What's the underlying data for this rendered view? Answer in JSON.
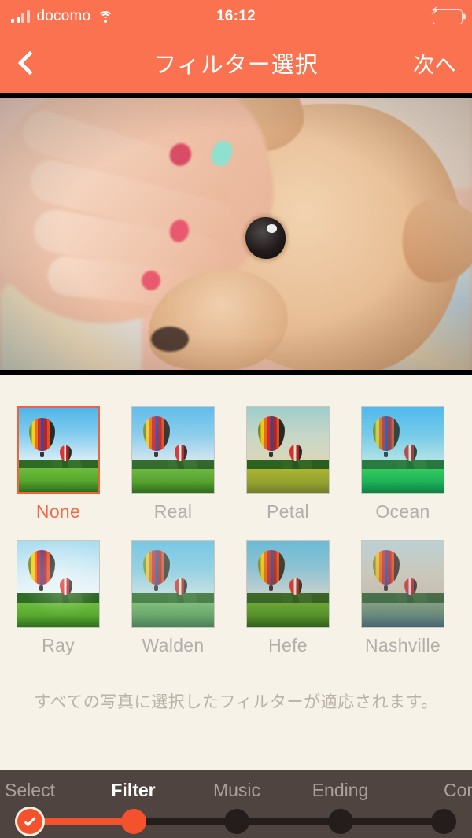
{
  "status_bar": {
    "carrier": "docomo",
    "time": "16:12",
    "signal_icon": "signal-bars-icon",
    "wifi_icon": "wifi-icon",
    "battery_icon": "battery-charging-icon",
    "battery_color": "#3ed64a"
  },
  "nav": {
    "back_icon": "chevron-left-icon",
    "title": "フィルター選択",
    "next_label": "次へ"
  },
  "preview": {
    "description": "chihuahua dog held by hands",
    "letterboxed": true
  },
  "filters": {
    "accent_color": "#f1613c",
    "inactive_color": "#b3aeaa",
    "selected": "None",
    "items": [
      {
        "label": "None",
        "fx": "none"
      },
      {
        "label": "Real",
        "fx": "real"
      },
      {
        "label": "Petal",
        "fx": "petal"
      },
      {
        "label": "Ocean",
        "fx": "ocean"
      },
      {
        "label": "Ray",
        "fx": "ray"
      },
      {
        "label": "Walden",
        "fx": "walden"
      },
      {
        "label": "Hefe",
        "fx": "hefe"
      },
      {
        "label": "Nashville",
        "fx": "nashville"
      }
    ],
    "note": "すべての写真に選択したフィルターが適応されます。"
  },
  "progress": {
    "bar_color": "#f4522c",
    "track_color": "#241d1b",
    "background": "#504440",
    "current_step": "Filter",
    "steps": [
      {
        "label": "Select",
        "state": "done"
      },
      {
        "label": "Filter",
        "state": "active"
      },
      {
        "label": "Music",
        "state": "pending"
      },
      {
        "label": "Ending",
        "state": "pending"
      },
      {
        "label": "Complete",
        "state": "pending"
      }
    ]
  }
}
